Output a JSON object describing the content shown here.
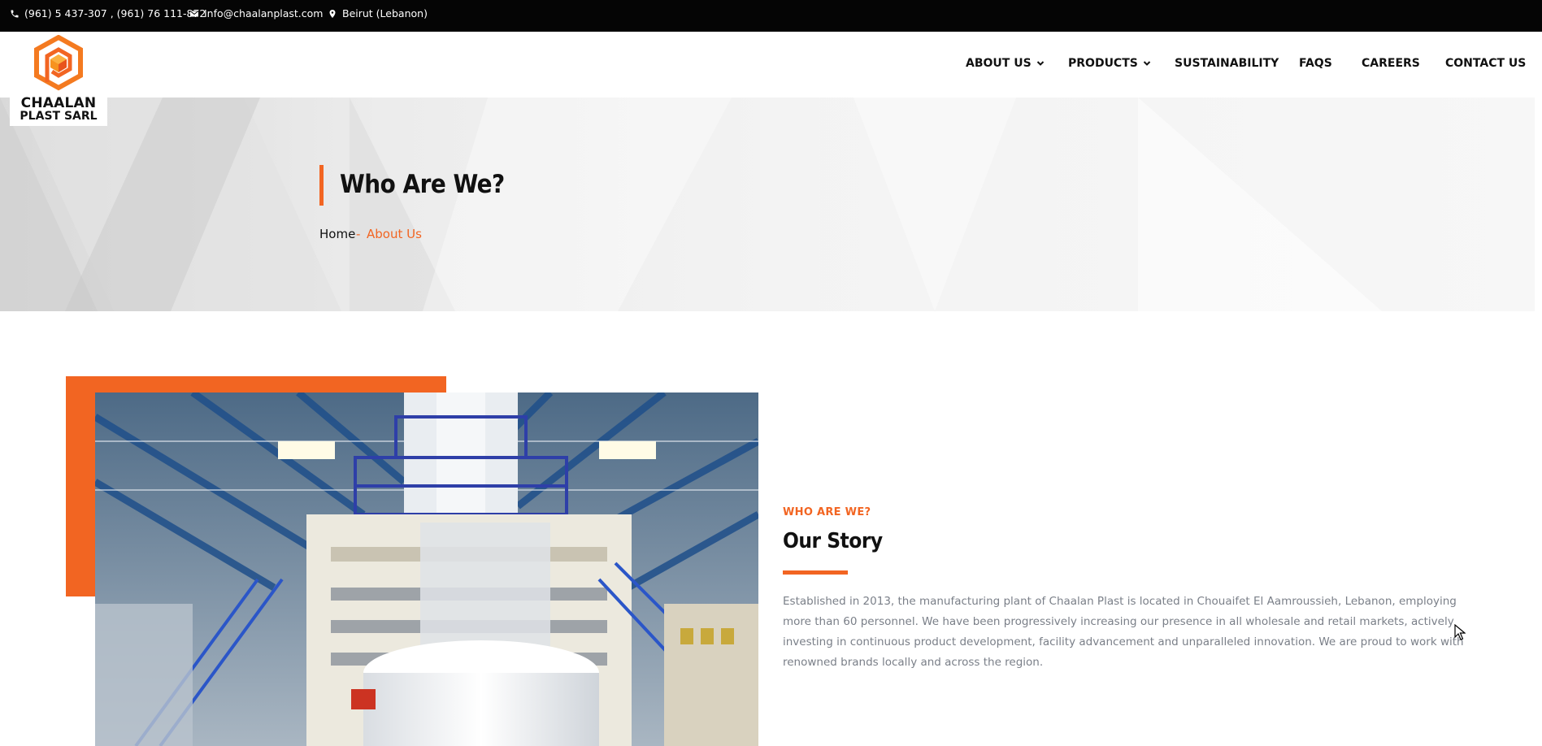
{
  "topbar": {
    "phone": "(961) 5 437-307 , (961) 76 111-872",
    "email": "Info@chaalanplast.com",
    "location": "Beirut (Lebanon)"
  },
  "logo": {
    "line1": "CHAALAN",
    "line2": "PLAST SARL"
  },
  "nav": {
    "items": [
      {
        "label": "ABOUT US",
        "dropdown": true
      },
      {
        "label": "PRODUCTS",
        "dropdown": true
      },
      {
        "label": "SUSTAINABILITY",
        "dropdown": false
      },
      {
        "label": "FAQS",
        "dropdown": false
      },
      {
        "label": "CAREERS",
        "dropdown": false
      },
      {
        "label": "CONTACT US",
        "dropdown": false
      }
    ]
  },
  "hero": {
    "title": "Who Are We?",
    "breadcrumb": {
      "home": "Home",
      "separator": "-",
      "current": "About Us"
    }
  },
  "story": {
    "eyebrow": "WHO ARE WE?",
    "title": "Our Story",
    "text": "Established in 2013, the manufacturing plant of Chaalan Plast is located in Chouaifet El Aamroussieh, Lebanon, employing more than 60 personnel. We have been progressively increasing our presence in all wholesale and retail markets, actively investing in continuous product development, facility advancement and unparalleled innovation. We are proud to work with renowned brands locally and across the region."
  },
  "colors": {
    "accent": "#f26522",
    "topbar": "#050505",
    "text": "#111111",
    "muted": "#7a7f88"
  }
}
